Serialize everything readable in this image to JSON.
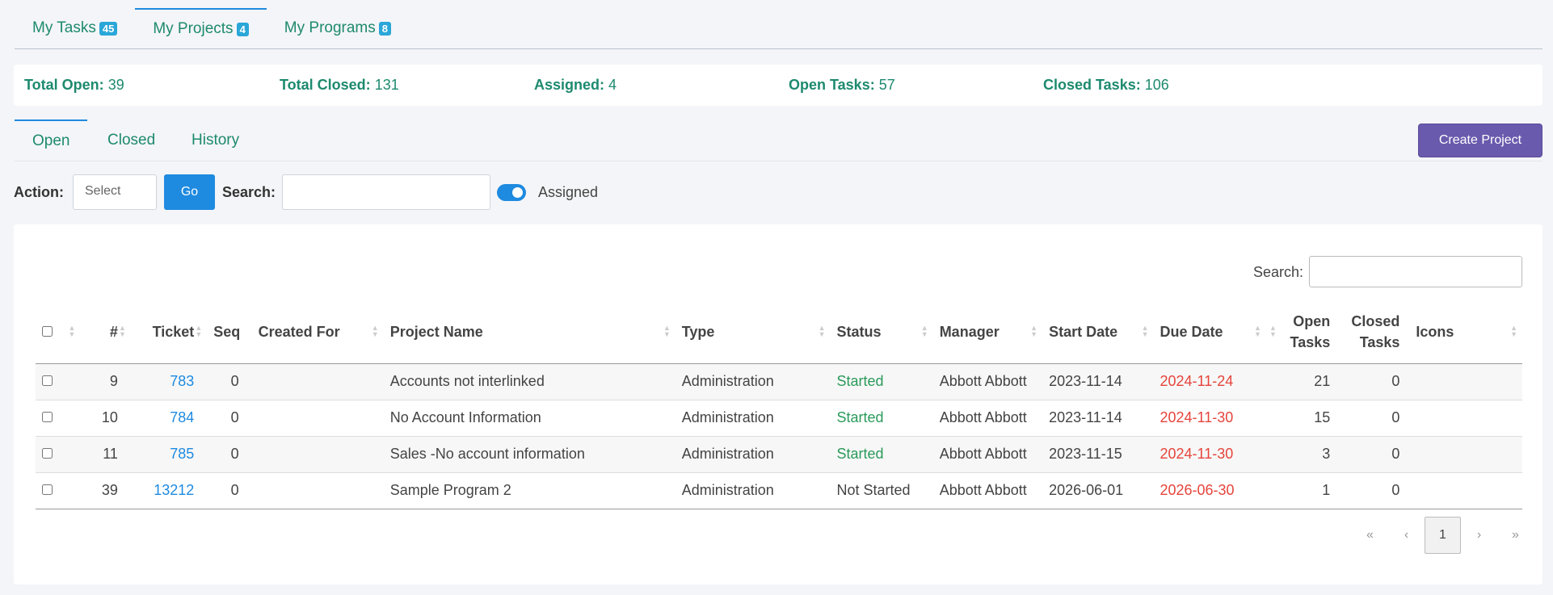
{
  "top_tabs": [
    {
      "label": "My Tasks",
      "badge": "45"
    },
    {
      "label": "My Projects",
      "badge": "4"
    },
    {
      "label": "My Programs",
      "badge": "8"
    }
  ],
  "stats": [
    {
      "label": "Total Open:",
      "value": "39"
    },
    {
      "label": "Total Closed:",
      "value": "131"
    },
    {
      "label": "Assigned:",
      "value": "4"
    },
    {
      "label": "Open Tasks:",
      "value": "57"
    },
    {
      "label": "Closed Tasks:",
      "value": "106"
    }
  ],
  "sub_tabs": [
    "Open",
    "Closed",
    "History"
  ],
  "create_button": "Create Project",
  "action": {
    "label": "Action:",
    "select_value": "Select",
    "go_label": "Go",
    "search_label": "Search:",
    "search_value": "",
    "toggle_label": "Assigned",
    "toggle_on": true
  },
  "table_search": {
    "label": "Search:",
    "value": ""
  },
  "columns": [
    "#",
    "Ticket",
    "Seq",
    "Created For",
    "Project Name",
    "Type",
    "Status",
    "Manager",
    "Start Date",
    "Due Date",
    "Open\nTasks",
    "Closed\nTasks",
    "Icons"
  ],
  "rows": [
    {
      "num": "9",
      "ticket": "783",
      "seq": "0",
      "created_for": "",
      "project": "Accounts not interlinked",
      "type": "Administration",
      "status": "Started",
      "manager": "Abbott Abbott",
      "start": "2023-11-14",
      "due": "2024-11-24",
      "open": "21",
      "closed": "0"
    },
    {
      "num": "10",
      "ticket": "784",
      "seq": "0",
      "created_for": "",
      "project": "No Account Information",
      "type": "Administration",
      "status": "Started",
      "manager": "Abbott Abbott",
      "start": "2023-11-14",
      "due": "2024-11-30",
      "open": "15",
      "closed": "0"
    },
    {
      "num": "11",
      "ticket": "785",
      "seq": "0",
      "created_for": "",
      "project": "Sales -No account information",
      "type": "Administration",
      "status": "Started",
      "manager": "Abbott Abbott",
      "start": "2023-11-15",
      "due": "2024-11-30",
      "open": "3",
      "closed": "0"
    },
    {
      "num": "39",
      "ticket": "13212",
      "seq": "0",
      "created_for": "",
      "project": "Sample Program 2",
      "type": "Administration",
      "status": "Not Started",
      "manager": "Abbott Abbott",
      "start": "2026-06-01",
      "due": "2026-06-30",
      "open": "1",
      "closed": "0"
    }
  ],
  "pagination": {
    "first": "«",
    "prev": "‹",
    "current": "1",
    "next": "›",
    "last": "»"
  },
  "colors": {
    "accent": "#1e8ae0",
    "tab_text": "#1d8a6e",
    "create": "#6a5aad",
    "started": "#2a9a5a",
    "due": "#e5453c"
  }
}
